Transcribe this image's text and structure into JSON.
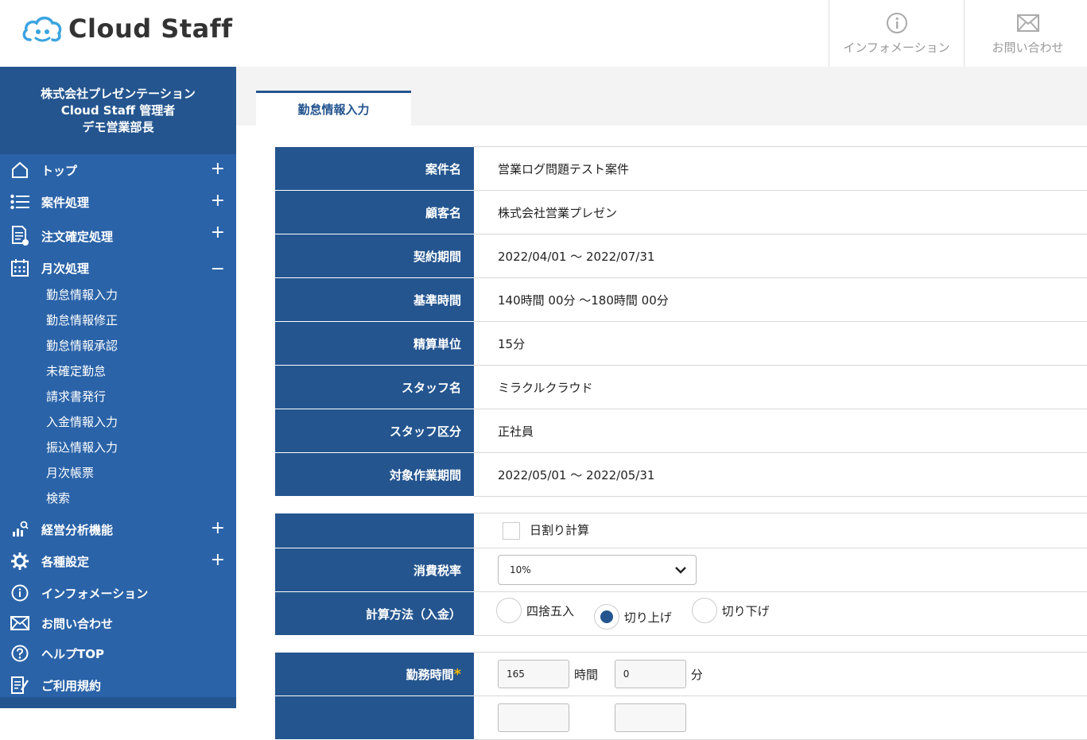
{
  "header": {
    "logo_text": "Cloud Staff",
    "info_label": "インフォメーション",
    "contact_label": "お問い合わせ"
  },
  "sidebar": {
    "user_company": "株式会社プレゼンテーション",
    "user_role": "Cloud Staff 管理者",
    "user_dept": "デモ営業部長",
    "items": [
      {
        "label": "トップ",
        "icon": "home-icon",
        "toggle": "+"
      },
      {
        "label": "案件処理",
        "icon": "list-icon",
        "toggle": "+"
      },
      {
        "label": "注文確定処理",
        "icon": "document-check-icon",
        "toggle": "+"
      },
      {
        "label": "月次処理",
        "icon": "calendar-icon",
        "toggle": "−"
      },
      {
        "label": "経営分析機能",
        "icon": "chart-icon",
        "toggle": "+"
      },
      {
        "label": "各種設定",
        "icon": "gear-icon",
        "toggle": "+"
      },
      {
        "label": "インフォメーション",
        "icon": "info-icon",
        "toggle": ""
      },
      {
        "label": "お問い合わせ",
        "icon": "mail-icon",
        "toggle": ""
      },
      {
        "label": "ヘルプTOP",
        "icon": "help-icon",
        "toggle": ""
      },
      {
        "label": "ご利用規約",
        "icon": "terms-icon",
        "toggle": ""
      }
    ],
    "sub_items": [
      "勤怠情報入力",
      "勤怠情報修正",
      "勤怠情報承認",
      "未確定勤怠",
      "請求書発行",
      "入金情報入力",
      "振込情報入力",
      "月次帳票",
      "検索"
    ]
  },
  "main": {
    "tab_label": "勤怠情報入力",
    "info_rows": [
      {
        "label": "案件名",
        "value": "営業ログ問題テスト案件"
      },
      {
        "label": "顧客名",
        "value": "株式会社営業プレゼン"
      },
      {
        "label": "契約期間",
        "value": "2022/04/01 〜 2022/07/31"
      },
      {
        "label": "基準時間",
        "value": "140時間 00分 〜180時間 00分"
      },
      {
        "label": "精算単位",
        "value": "15分"
      },
      {
        "label": "スタッフ名",
        "value": "ミラクルクラウド"
      },
      {
        "label": "スタッフ区分",
        "value": "正社員"
      },
      {
        "label": "対象作業期間",
        "value": "2022/05/01 〜 2022/05/31"
      }
    ],
    "daily_calc_label": "日割り計算",
    "tax_label": "消費税率",
    "tax_value": "10%",
    "calc_label": "計算方法（入金）",
    "calc_options": [
      "四捨五入",
      "切り上げ",
      "切り下げ"
    ],
    "calc_selected": "切り上げ",
    "work_time_label": "勤務時間",
    "work_hours": "165",
    "hours_unit": "時間",
    "work_minutes": "0",
    "minutes_unit": "分"
  }
}
